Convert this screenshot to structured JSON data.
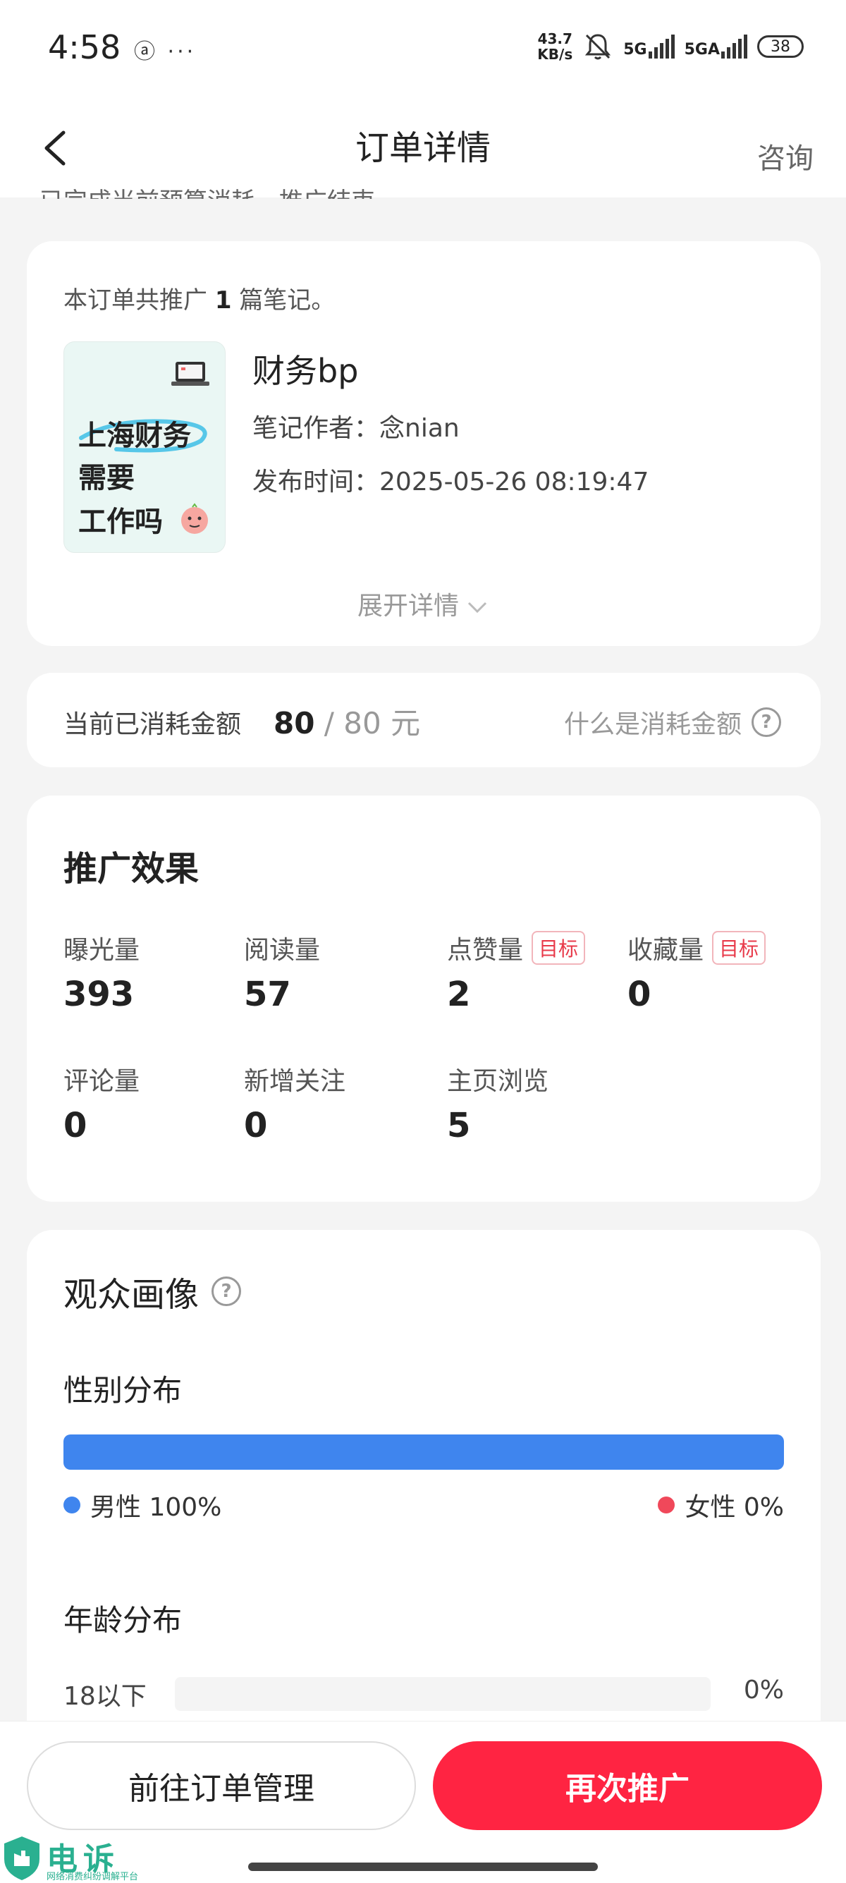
{
  "status": {
    "time": "4:58",
    "left_icons": "ⓐ ···",
    "speed_value": "43.7",
    "speed_unit": "KB/s",
    "net1": "5G",
    "net2": "5GA",
    "battery": "38"
  },
  "nav": {
    "title": "订单详情",
    "consult": "咨询"
  },
  "peek_text": "已完成当前预算消耗，推广结束",
  "order": {
    "intro_prefix": "本订单共推广 ",
    "note_count": "1",
    "intro_suffix": " 篇笔记。",
    "thumb_lines": [
      "上海财务",
      "需要",
      "工作吗"
    ],
    "note_title": "财务bp",
    "author_label": "笔记作者：",
    "author": "念nian",
    "publish_label": "发布时间：",
    "publish_time": "2025-05-26 08:19:47",
    "expand": "展开详情"
  },
  "spend": {
    "label": "当前已消耗金额",
    "spent": "80",
    "total": " / 80 元",
    "help": "什么是消耗金额"
  },
  "effect": {
    "title": "推广效果",
    "target_tag": "目标",
    "metrics": [
      {
        "label": "曝光量",
        "value": "393"
      },
      {
        "label": "阅读量",
        "value": "57"
      },
      {
        "label": "点赞量",
        "value": "2"
      },
      {
        "label": "收藏量",
        "value": "0"
      },
      {
        "label": "评论量",
        "value": "0"
      },
      {
        "label": "新增关注",
        "value": "0"
      },
      {
        "label": "主页浏览",
        "value": "5"
      }
    ]
  },
  "audience": {
    "title": "观众画像",
    "gender_title": "性别分布",
    "male_pct": 1.0,
    "male": "男性 100%",
    "female": "女性 0%",
    "male_color": "#3f85ee",
    "female_color": "#f0485a",
    "age_title": "年龄分布",
    "age_rows": [
      {
        "label": "18以下",
        "pct": "0%"
      }
    ]
  },
  "actions": {
    "manage": "前往订单管理",
    "again": "再次推广"
  },
  "watermark": {
    "name": "电诉宝",
    "sub": "网络消费纠纷调解平台"
  }
}
